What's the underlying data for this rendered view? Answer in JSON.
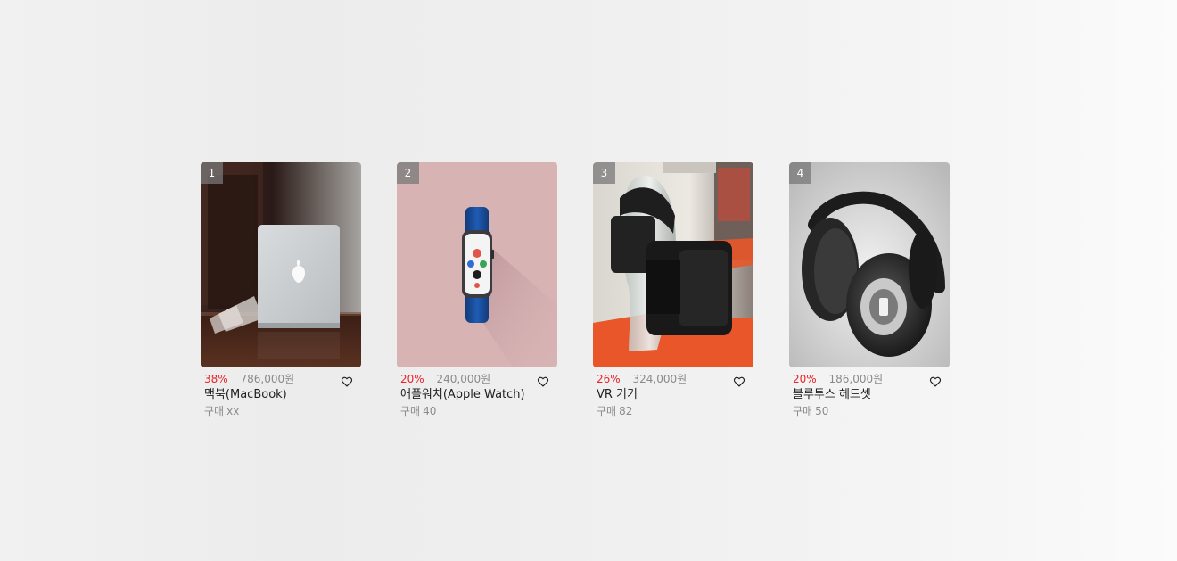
{
  "products": [
    {
      "rank": "1",
      "discount": "38%",
      "price": "786,000원",
      "name": "맥북(MacBook)",
      "purchase_label": "구매",
      "purchase_count": "xx",
      "image_icon": "laptop-photo"
    },
    {
      "rank": "2",
      "discount": "20%",
      "price": "240,000원",
      "name": "애플워치(Apple Watch)",
      "purchase_label": "구매",
      "purchase_count": "40",
      "image_icon": "smartwatch-photo"
    },
    {
      "rank": "3",
      "discount": "26%",
      "price": "324,000원",
      "name": "VR 기기",
      "purchase_label": "구매",
      "purchase_count": "82",
      "image_icon": "vr-headset-photo"
    },
    {
      "rank": "4",
      "discount": "20%",
      "price": "186,000원",
      "name": "블루투스 헤드셋",
      "purchase_label": "구매",
      "purchase_count": "50",
      "image_icon": "headphones-photo"
    }
  ],
  "colors": {
    "discount": "#e8242b",
    "muted": "#8a8a8a",
    "text": "#222222"
  },
  "icons": {
    "wishlist": "heart-outline-icon"
  }
}
